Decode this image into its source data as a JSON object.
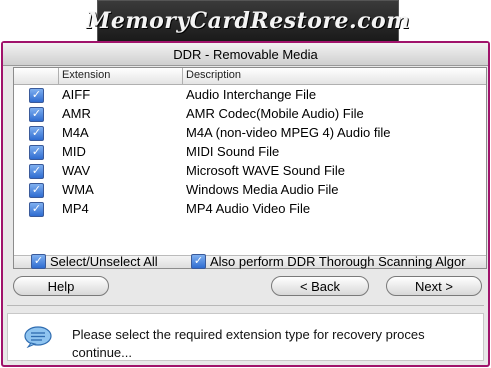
{
  "banner": {
    "text": "MemoryCardRestore.com"
  },
  "window": {
    "title": "DDR - Removable Media"
  },
  "table": {
    "columns": {
      "extension": "Extension",
      "description": "Description"
    },
    "rows": [
      {
        "checked": true,
        "extension": "AIFF",
        "description": "Audio Interchange File"
      },
      {
        "checked": true,
        "extension": "AMR",
        "description": "AMR Codec(Mobile Audio) File"
      },
      {
        "checked": true,
        "extension": "M4A",
        "description": "M4A (non-video MPEG 4) Audio file"
      },
      {
        "checked": true,
        "extension": "MID",
        "description": "MIDI Sound File"
      },
      {
        "checked": true,
        "extension": "WAV",
        "description": "Microsoft WAVE Sound File"
      },
      {
        "checked": true,
        "extension": "WMA",
        "description": "Windows Media Audio File"
      },
      {
        "checked": true,
        "extension": "MP4",
        "description": "MP4 Audio Video File"
      }
    ]
  },
  "options": {
    "select_all": {
      "label": "Select/Unselect All",
      "checked": true
    },
    "thorough_scan": {
      "label": "Also perform DDR Thorough Scanning Algor",
      "checked": true
    }
  },
  "buttons": {
    "help": "Help",
    "back": "< Back",
    "next": "Next >"
  },
  "info": {
    "line1": "Please select the required extension type for recovery proces",
    "line2": "continue..."
  },
  "colors": {
    "frame_border": "#a0136b",
    "checkbox": "#2f6cd0"
  }
}
